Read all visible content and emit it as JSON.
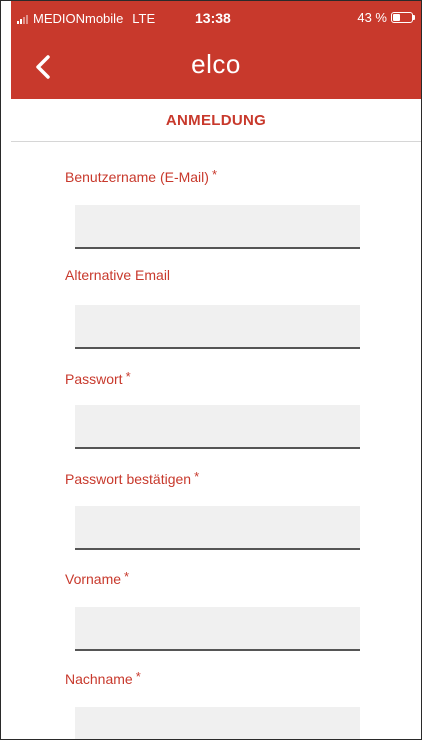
{
  "status_bar": {
    "carrier": "MEDIONmobile",
    "network": "LTE",
    "time": "13:38",
    "battery_text": "43 %",
    "battery_level": 0.43
  },
  "header": {
    "back_icon": "chevron-left-icon",
    "brand": "elco",
    "title": "ANMELDUNG"
  },
  "form": {
    "required_marker": "*",
    "fields": [
      {
        "label": "Benutzername (E-Mail)",
        "required": true,
        "value": ""
      },
      {
        "label": "Alternative Email",
        "required": false,
        "value": ""
      },
      {
        "label": "Passwort",
        "required": true,
        "value": ""
      },
      {
        "label": "Passwort bestätigen",
        "required": true,
        "value": ""
      },
      {
        "label": "Vorname",
        "required": true,
        "value": ""
      },
      {
        "label": "Nachname",
        "required": true,
        "value": ""
      }
    ]
  },
  "colors": {
    "accent": "#c8392c",
    "input_background": "#f0f0f0",
    "input_underline": "#555555"
  }
}
